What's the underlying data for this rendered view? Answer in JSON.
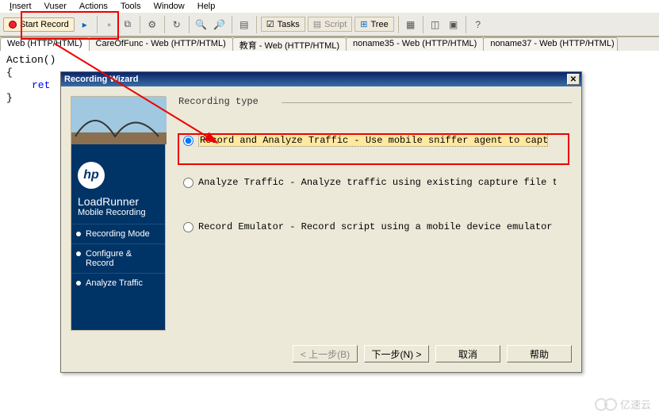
{
  "menu": {
    "insert": "Insert",
    "vuser": "Vuser",
    "actions": "Actions",
    "tools": "Tools",
    "window": "Window",
    "help": "Help"
  },
  "toolbar": {
    "start_record": "Start Record",
    "tasks": "Tasks",
    "script": "Script",
    "tree": "Tree"
  },
  "tabs": [
    "Web (HTTP/HTML)",
    "CareOfFunc - Web (HTTP/HTML)",
    "教育 - Web (HTTP/HTML)",
    "noname35 - Web (HTTP/HTML)",
    "noname37 - Web (HTTP/HTML)"
  ],
  "code": {
    "l1": "Action()",
    "l2": "{",
    "l3": "ret",
    "l4": "}"
  },
  "dialog": {
    "title": "Recording Wizard",
    "brand1": "LoadRunner",
    "brand2": "Mobile Recording",
    "steps": [
      "Recording Mode",
      "Configure & Record",
      "Analyze Traffic"
    ],
    "group": "Recording type",
    "opt1": "Record and Analyze Traffic - Use mobile sniffer agent to capture traffic a",
    "opt2": "Analyze Traffic - Analyze traffic using existing capture file to generate",
    "opt3": "Record Emulator -  Record script using a mobile device emulator",
    "btn_back": "< 上一步(B)",
    "btn_next": "下一步(N) >",
    "btn_cancel": "取消",
    "btn_help": "帮助"
  },
  "watermark": "亿速云"
}
